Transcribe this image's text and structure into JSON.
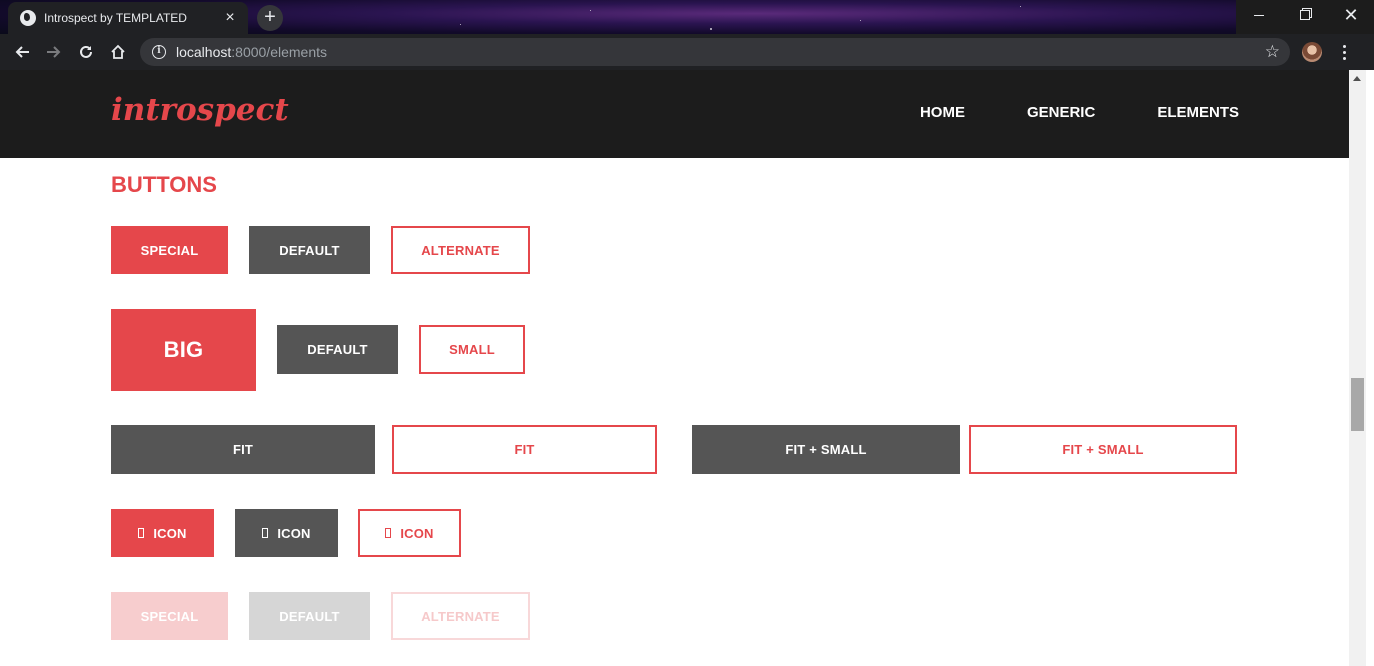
{
  "browser": {
    "tab_title": "Introspect by TEMPLATED",
    "tab_close": "×",
    "new_tab": "+",
    "url_host": "localhost",
    "url_rest": ":8000/elements",
    "info_glyph": "i",
    "bookmark_glyph": "☆",
    "window_close": "✕"
  },
  "site": {
    "logo": "introspect",
    "nav": [
      "HOME",
      "GENERIC",
      "ELEMENTS"
    ]
  },
  "section": {
    "title": "BUTTONS"
  },
  "buttons": {
    "row1": [
      "SPECIAL",
      "DEFAULT",
      "ALTERNATE"
    ],
    "row2": [
      "BIG",
      "DEFAULT",
      "SMALL"
    ],
    "row3": [
      "FIT",
      "FIT",
      "FIT + SMALL",
      "FIT + SMALL"
    ],
    "row4": [
      "ICON",
      "ICON",
      "ICON"
    ],
    "row5": [
      "SPECIAL",
      "DEFAULT",
      "ALTERNATE"
    ]
  },
  "colors": {
    "accent": "#e5474b",
    "dark": "#555555",
    "header": "#1c1c1c"
  }
}
